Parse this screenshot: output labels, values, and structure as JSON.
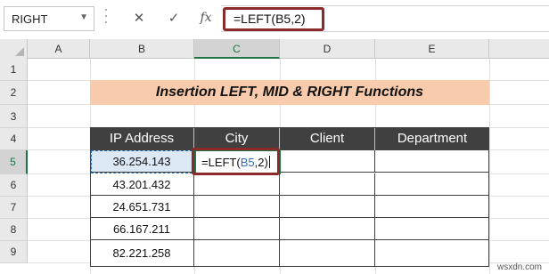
{
  "formula_bar": {
    "name_box": "RIGHT",
    "cancel_icon": "✕",
    "enter_icon": "✓",
    "fx_label": "fx",
    "formula": "=LEFT(B5,2)"
  },
  "sheet": {
    "columns": [
      "A",
      "B",
      "C",
      "D",
      "E"
    ],
    "active_column": "C",
    "rows": [
      "1",
      "2",
      "3",
      "4",
      "5",
      "6",
      "7",
      "8",
      "9"
    ],
    "active_row": "5",
    "title": "Insertion LEFT, MID & RIGHT Functions",
    "table": {
      "headers": [
        "IP Address",
        "City",
        "Client",
        "Department"
      ],
      "ip_addresses": [
        "36.254.143",
        "43.201.432",
        "24.651.731",
        "66.167.211",
        "82.221.258"
      ],
      "active_cell_formula": {
        "prefix": "=LEFT(",
        "ref": "B5",
        "suffix": ",2)"
      }
    }
  },
  "watermark": "wsxdn.com",
  "colors": {
    "title_band": "#f8cbad",
    "table_header": "#404040",
    "highlight_border": "#8b2a2a",
    "selection": "#217346"
  }
}
